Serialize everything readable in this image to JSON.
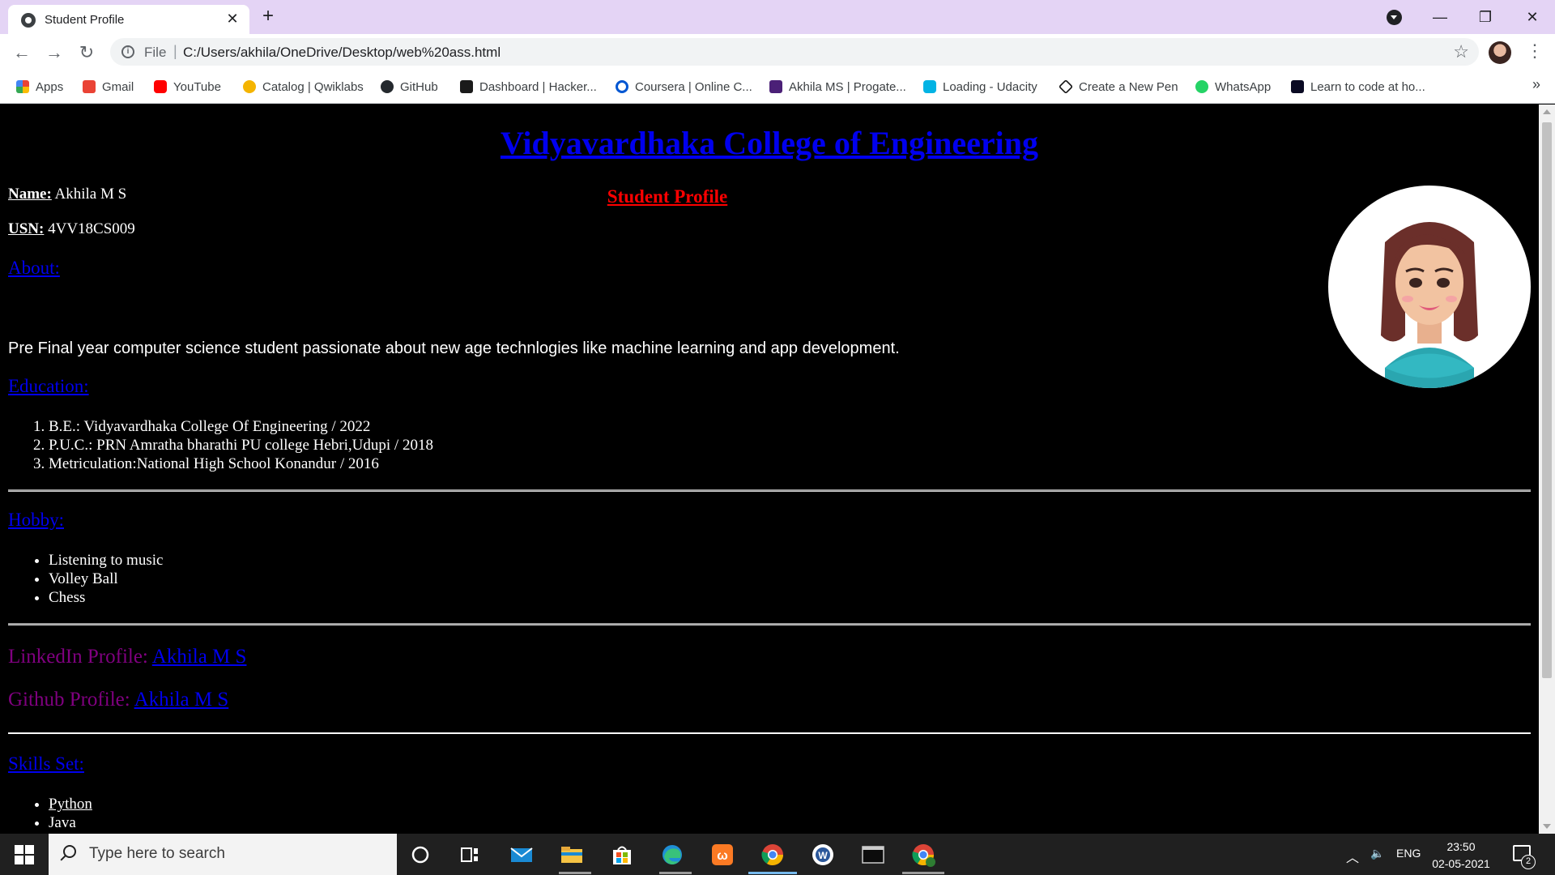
{
  "browser": {
    "tab_title": "Student Profile",
    "tab_close": "✕",
    "new_tab": "+",
    "scheme": "File",
    "url": "C:/Users/akhila/OneDrive/Desktop/web%20ass.html",
    "window_controls": {
      "minimize": "—",
      "maximize": "❐",
      "close": "✕"
    }
  },
  "bookmarks": [
    {
      "label": "Apps",
      "icon": "apps-grid-icon",
      "color": "#4285f4"
    },
    {
      "label": "Gmail",
      "icon": "gmail-icon",
      "color": "#ea4335"
    },
    {
      "label": "YouTube",
      "icon": "youtube-icon",
      "color": "#ff0000"
    },
    {
      "label": "Catalog | Qwiklabs",
      "icon": "qwiklabs-icon",
      "color": "#f4b400"
    },
    {
      "label": "GitHub",
      "icon": "github-icon",
      "color": "#24292e"
    },
    {
      "label": "Dashboard | Hacker...",
      "icon": "hackerrank-icon",
      "color": "#1a1a1a"
    },
    {
      "label": "Coursera | Online C...",
      "icon": "coursera-icon",
      "color": "#0056d2"
    },
    {
      "label": "Akhila MS | Progate...",
      "icon": "progate-icon",
      "color": "#4b2077"
    },
    {
      "label": "Loading - Udacity",
      "icon": "udacity-icon",
      "color": "#02b3e4"
    },
    {
      "label": "Create a New Pen",
      "icon": "codepen-icon",
      "color": "#111111"
    },
    {
      "label": "WhatsApp",
      "icon": "whatsapp-icon",
      "color": "#25d366"
    },
    {
      "label": "Learn to code at ho...",
      "icon": "freecodecamp-icon",
      "color": "#0a0a23"
    }
  ],
  "page": {
    "college": "Vidyavardhaka College of Engineering",
    "subtitle": "Student Profile",
    "name_label": "Name:",
    "name_value": "Akhila M S",
    "usn_label": "USN:",
    "usn_value": "4VV18CS009",
    "about_heading": "About:",
    "about_text": "Pre Final year computer science student passionate about new age technlogies like machine learning and app development.",
    "education_heading": "Education:",
    "education": [
      "B.E.: Vidyavardhaka College Of Engineering / 2022",
      "P.U.C.: PRN Amratha bharathi PU college Hebri,Udupi / 2018",
      "Metriculation:National High School Konandur / 2016"
    ],
    "hobby_heading": "Hobby:",
    "hobbies": [
      "Listening to music",
      "Volley Ball",
      "Chess"
    ],
    "linkedin_label": "LinkedIn Profile:",
    "linkedin_link": "Akhila M S",
    "github_label": "Github Profile:",
    "github_link": "Akhila M S",
    "skills_heading": "Skills Set:",
    "skills": [
      "Python",
      "Java"
    ]
  },
  "taskbar": {
    "search_placeholder": "Type here to search",
    "language": "ENG",
    "time": "23:50",
    "date": "02-05-2021",
    "notifications": "2"
  }
}
